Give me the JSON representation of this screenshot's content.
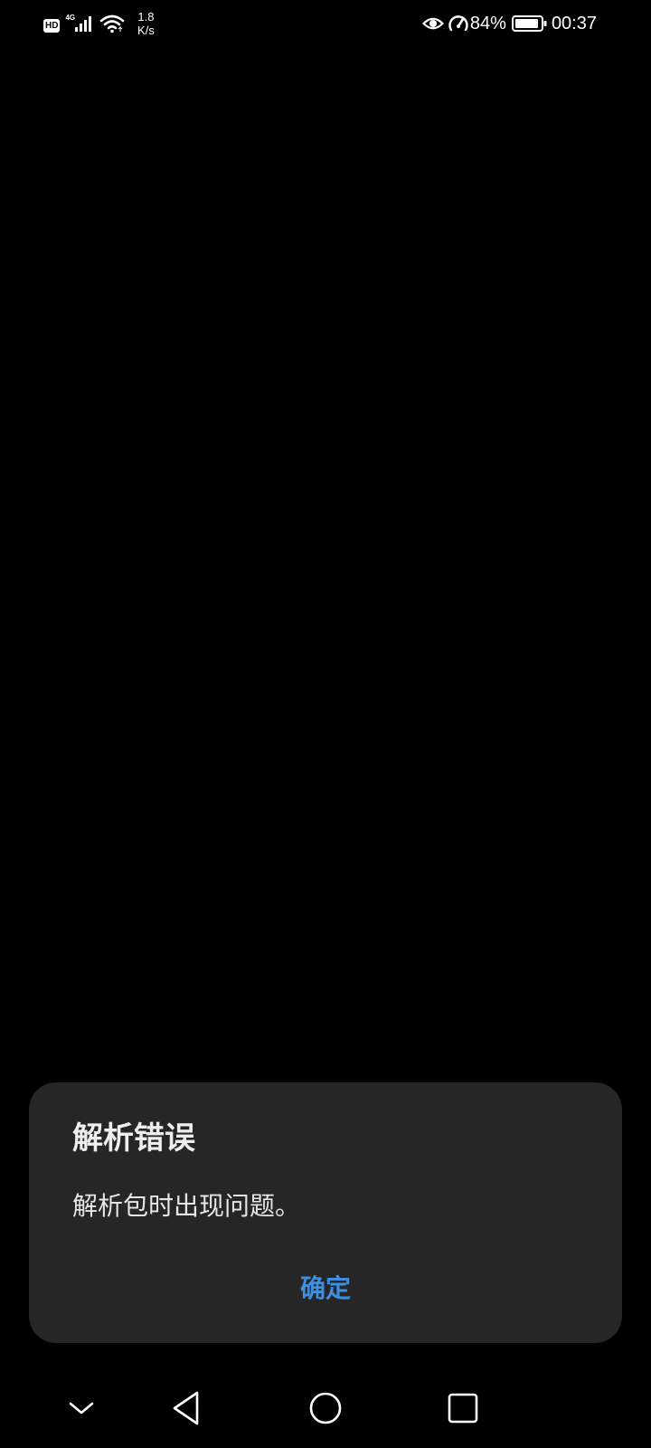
{
  "status_bar": {
    "hd_label": "HD",
    "network_generation": "4G",
    "net_speed_value": "1.8",
    "net_speed_unit": "K/s",
    "battery_percent": "84%",
    "time": "00:37",
    "icons": {
      "signal": "cellular-signal-icon",
      "wifi": "wifi-icon",
      "eye": "eye-comfort-icon",
      "speed": "performance-mode-icon",
      "battery": "battery-icon"
    }
  },
  "dialog": {
    "title": "解析错误",
    "message": "解析包时出现问题。",
    "ok_label": "确定"
  },
  "nav_bar": {
    "icons": [
      "chevron-down-icon",
      "back-icon",
      "home-icon",
      "recents-icon"
    ]
  },
  "colors": {
    "background": "#000000",
    "dialog_background": "#262626",
    "accent": "#3d8fe0",
    "text_primary": "#eeeeee"
  }
}
